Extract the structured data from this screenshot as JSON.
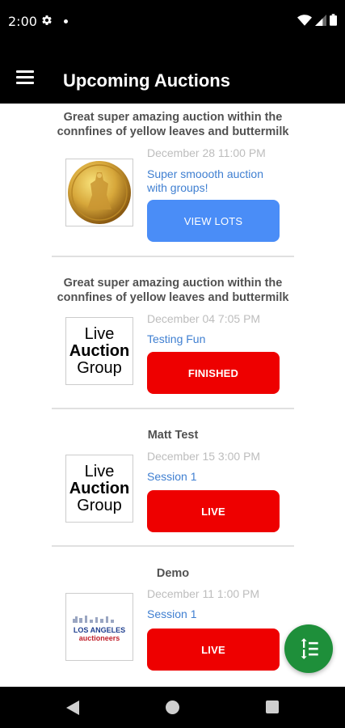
{
  "status_bar": {
    "time": "2:00"
  },
  "app_bar": {
    "title": "Upcoming Auctions"
  },
  "auctions": [
    {
      "title": "Great super amazing auction within the connfines of yellow leaves and buttermilk",
      "date": "December 28 11:00 PM",
      "subtitle": "Super smoooth auction with groups!",
      "button": "VIEW LOTS",
      "image": "gold-coin"
    },
    {
      "title": "Great super amazing auction within the connfines of yellow leaves and buttermilk",
      "date": "December 04 7:05 PM",
      "subtitle": "Testing Fun",
      "button": "FINISHED",
      "image": "live-auction-group-logo"
    },
    {
      "title": "Matt Test",
      "date": "December 15 3:00 PM",
      "subtitle": "Session 1",
      "button": "LIVE",
      "image": "live-auction-group-logo"
    },
    {
      "title": "Demo",
      "date": "December 11 1:00 PM",
      "subtitle": "Session 1",
      "button": "LIVE",
      "image": "los-angeles-auctioneers-logo"
    }
  ],
  "logos": {
    "live_auction_group": {
      "line1": "Live",
      "line2": "Auction",
      "line3": "Group"
    },
    "los_angeles": {
      "line1": "LOS ANGELES",
      "line2": "auctioneers"
    }
  },
  "colors": {
    "primary_button": "#4a8df7",
    "red_button": "#ee0000",
    "fab": "#1e8f3a",
    "link_text": "#3f7fd1"
  }
}
